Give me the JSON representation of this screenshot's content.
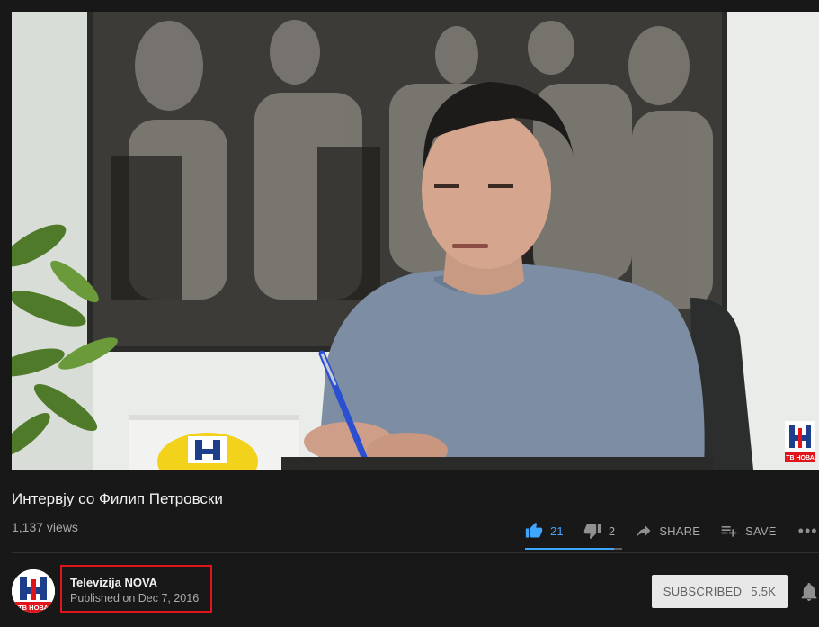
{
  "video": {
    "logo_text": "ТВ НОВА"
  },
  "title": "Интервју со Филип Петровски",
  "views": "1,137 views",
  "actions": {
    "like_count": "21",
    "dislike_count": "2",
    "share_label": "SHARE",
    "save_label": "SAVE",
    "more_label": "•••"
  },
  "like_ratio": 0.913,
  "owner": {
    "channel_name": "Televizija NOVA",
    "published": "Published on Dec 7, 2016",
    "avatar_logo_text": "ТВ НОВА"
  },
  "subscribe": {
    "label": "SUBSCRIBED",
    "count": "5.5K"
  },
  "colors": {
    "accent_blue": "#3ea6ff",
    "highlight_red": "#e1141a",
    "background": "#181818"
  }
}
